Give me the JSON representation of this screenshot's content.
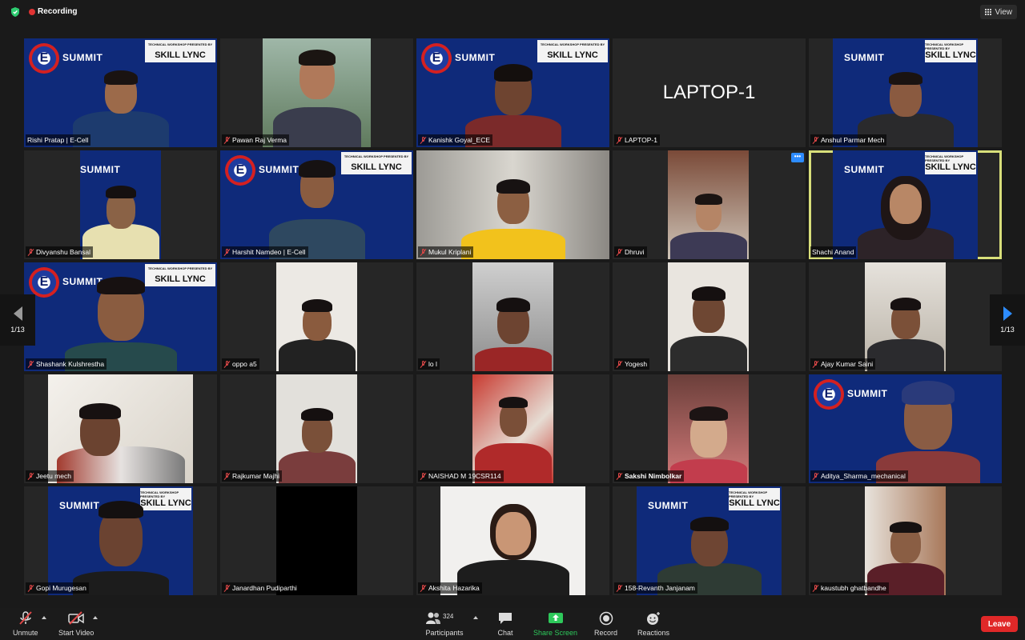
{
  "topbar": {
    "recording_label": "Recording",
    "view_label": "View",
    "recording_color": "#e03333",
    "shield_color": "#2ecc71"
  },
  "gallery": {
    "page_indicator_left": "1/13",
    "page_indicator_right": "1/13",
    "tiles": [
      {
        "name": "Rishi Pratap | E-Cell",
        "muted": false
      },
      {
        "name": "Pawan Raj Verma",
        "muted": true
      },
      {
        "name": "Kanishk Goyal_ECE",
        "muted": true
      },
      {
        "name": "LAPTOP-1",
        "muted": true,
        "center_label": "LAPTOP-1"
      },
      {
        "name": "Anshul Parmar Mech",
        "muted": true
      },
      {
        "name": "Divyanshu Bansal",
        "muted": true
      },
      {
        "name": "Harshit Namdeo | E-Cell",
        "muted": true
      },
      {
        "name": "Mukul Kriplani",
        "muted": true
      },
      {
        "name": "Dhruvi",
        "muted": true
      },
      {
        "name": "Shachi Anand",
        "muted": false,
        "active_speaker": true
      },
      {
        "name": "Shashank Kulshrestha",
        "muted": true
      },
      {
        "name": "oppo a5",
        "muted": true
      },
      {
        "name": "lo l",
        "muted": true
      },
      {
        "name": "Yogesh",
        "muted": true
      },
      {
        "name": "Ajay Kumar Saini",
        "muted": true
      },
      {
        "name": "Jeetu mech",
        "muted": true
      },
      {
        "name": "Rajkumar Majhi",
        "muted": true
      },
      {
        "name": "NAISHAD  M 19CSR114",
        "muted": true
      },
      {
        "name": "Sakshi Nimbolkar",
        "muted": true
      },
      {
        "name": "Aditya_Sharma_mechanical",
        "muted": true
      },
      {
        "name": "Gopi Murugesan",
        "muted": true
      },
      {
        "name": "Janardhan Pudiparthi",
        "muted": true
      },
      {
        "name": "Akshita Hazarika",
        "muted": true
      },
      {
        "name": "158-Revanth Janjanam",
        "muted": true
      },
      {
        "name": "kaustubh ghatbandhe",
        "muted": true
      }
    ],
    "banner": {
      "e_letter": "E",
      "summit": "SUMMIT",
      "skill": "SKILL LYNC",
      "workshop": "TECHNICAL WORKSHOP PRESENTED BY"
    },
    "more_button": "•••"
  },
  "toolbar": {
    "unmute": "Unmute",
    "start_video": "Start Video",
    "participants": "Participants",
    "participant_count": "324",
    "chat": "Chat",
    "share_screen": "Share Screen",
    "record": "Record",
    "reactions": "Reactions",
    "leave": "Leave",
    "share_color": "#2ec95b",
    "leave_color": "#e02828"
  }
}
